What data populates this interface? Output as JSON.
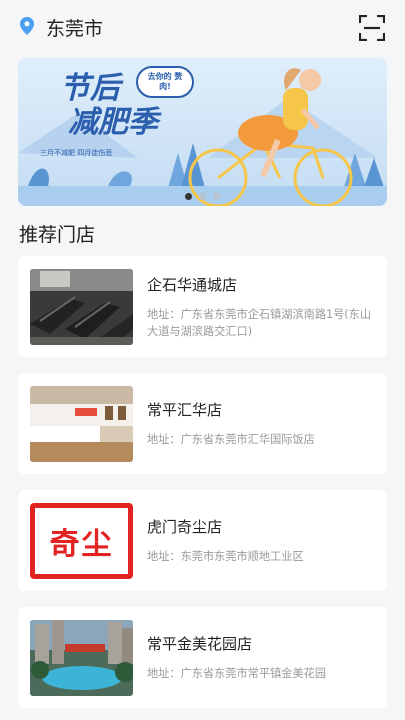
{
  "header": {
    "city": "东莞市"
  },
  "banner": {
    "slogan_line1": "节后",
    "slogan_line2": "减肥季",
    "bubble_text": "去你的 赘肉!",
    "sub_text": "三月不减肥 四月徒伤悲",
    "slide_count": 3,
    "active_slide": 1
  },
  "section": {
    "title": "推荐门店"
  },
  "stores": [
    {
      "name": "企石华通城店",
      "address": "地址：广东省东莞市企石镇湖滨南路1号(东山大道与湖滨路交汇口)",
      "thumb": "gym-treadmills-photo"
    },
    {
      "name": "常平汇华店",
      "address": "地址：广东省东莞市汇华国际饭店",
      "thumb": "reception-desk-photo"
    },
    {
      "name": "虎门奇尘店",
      "address": "地址：东莞市东莞市顺地工业区",
      "thumb": "qichen-logo",
      "logo_text": "奇尘"
    },
    {
      "name": "常平金美花园店",
      "address": "地址：广东省东莞市常平镇金美花园",
      "thumb": "pool-garden-photo"
    }
  ]
}
